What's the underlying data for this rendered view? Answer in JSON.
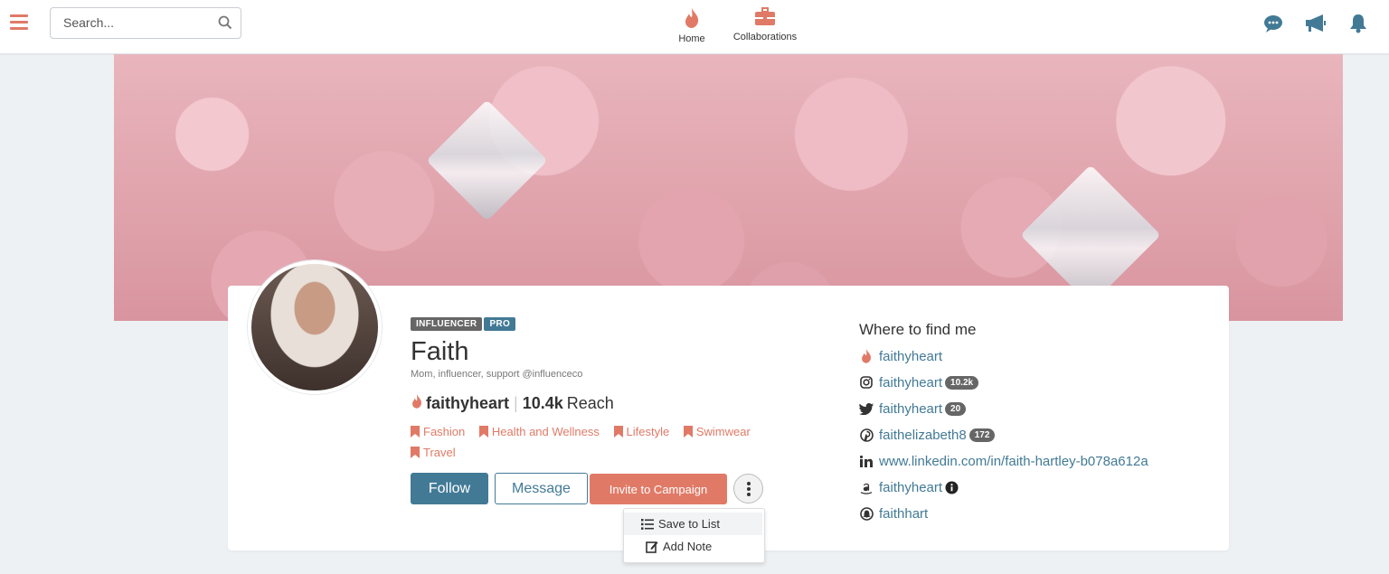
{
  "topbar": {
    "search_placeholder": "Search...",
    "nav": [
      {
        "label": "Home",
        "icon": "flame-icon"
      },
      {
        "label": "Collaborations",
        "icon": "briefcase-icon"
      }
    ],
    "right_icons": [
      "chat-icon",
      "megaphone-icon",
      "bell-icon"
    ]
  },
  "profile": {
    "badges": [
      "INFLUENCER",
      "PRO"
    ],
    "name": "Faith",
    "bio": "Mom, influencer, support @influenceco",
    "handle": "faithyheart",
    "reach_value": "10.4k",
    "reach_label": "Reach",
    "tags": [
      "Fashion",
      "Health and Wellness",
      "Lifestyle",
      "Swimwear",
      "Travel"
    ]
  },
  "actions": {
    "follow": "Follow",
    "message": "Message",
    "invite": "Invite to Campaign"
  },
  "menu": {
    "save_to_list": "Save to List",
    "add_note": "Add Note"
  },
  "find_me": {
    "title": "Where to find me",
    "links": [
      {
        "network": "influenceco",
        "icon": "flame-icon",
        "text": "faithyheart",
        "count": ""
      },
      {
        "network": "instagram",
        "icon": "instagram-icon",
        "text": "faithyheart",
        "count": "10.2k"
      },
      {
        "network": "twitter",
        "icon": "twitter-icon",
        "text": "faithyheart",
        "count": "20"
      },
      {
        "network": "pinterest",
        "icon": "pinterest-icon",
        "text": "faithelizabeth8",
        "count": "172"
      },
      {
        "network": "linkedin",
        "icon": "linkedin-icon",
        "text": "www.linkedin.com/in/faith-hartley-b078a612a",
        "count": ""
      },
      {
        "network": "amazon",
        "icon": "amazon-icon",
        "text": "faithyheart",
        "count": ""
      },
      {
        "network": "snapchat",
        "icon": "snapchat-icon",
        "text": "faithhart",
        "count": ""
      }
    ]
  },
  "colors": {
    "accent": "#e07a67",
    "primary": "#427a96",
    "badge_influencer": "#666666",
    "badge_pro": "#427a96"
  }
}
